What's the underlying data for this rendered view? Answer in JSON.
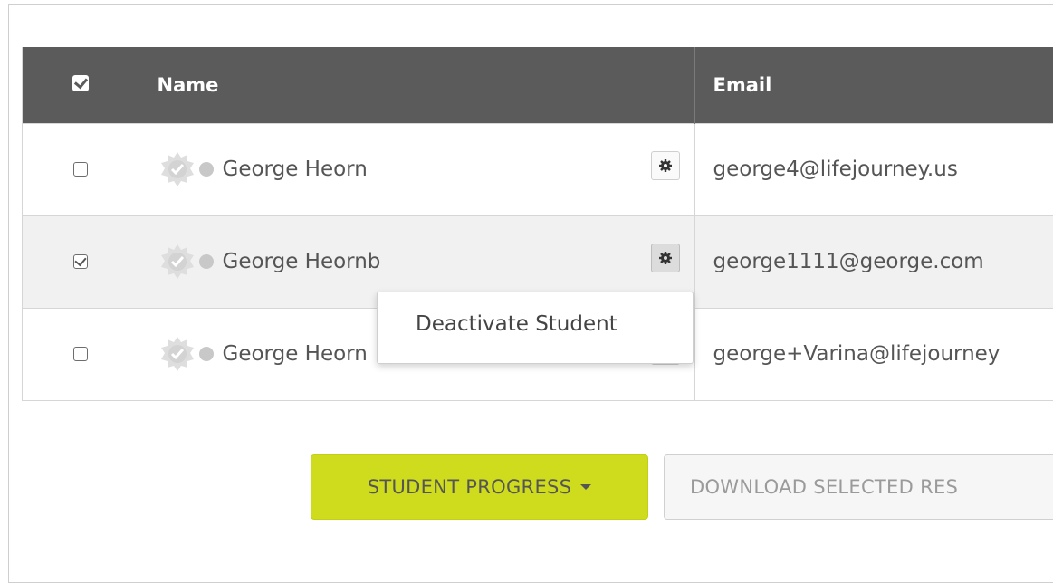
{
  "table": {
    "columns": [
      "Name",
      "Email"
    ],
    "rows": [
      {
        "checked": false,
        "name": "George Heorn",
        "email": "george4@lifejourney.us"
      },
      {
        "checked": true,
        "name": "George Heornb",
        "email": "george1111@george.com"
      },
      {
        "checked": false,
        "name": "George Heorn",
        "email": "george+Varina@lifejourney"
      }
    ]
  },
  "context_menu": {
    "item": "Deactivate Student"
  },
  "buttons": {
    "student_progress": "STUDENT PROGRESS",
    "download_selected": "DOWNLOAD SELECTED RES"
  },
  "colors": {
    "header_bg": "#5b5b5b",
    "progress_button": "#cfdc1e",
    "status_dot": "#c8c8c8"
  }
}
